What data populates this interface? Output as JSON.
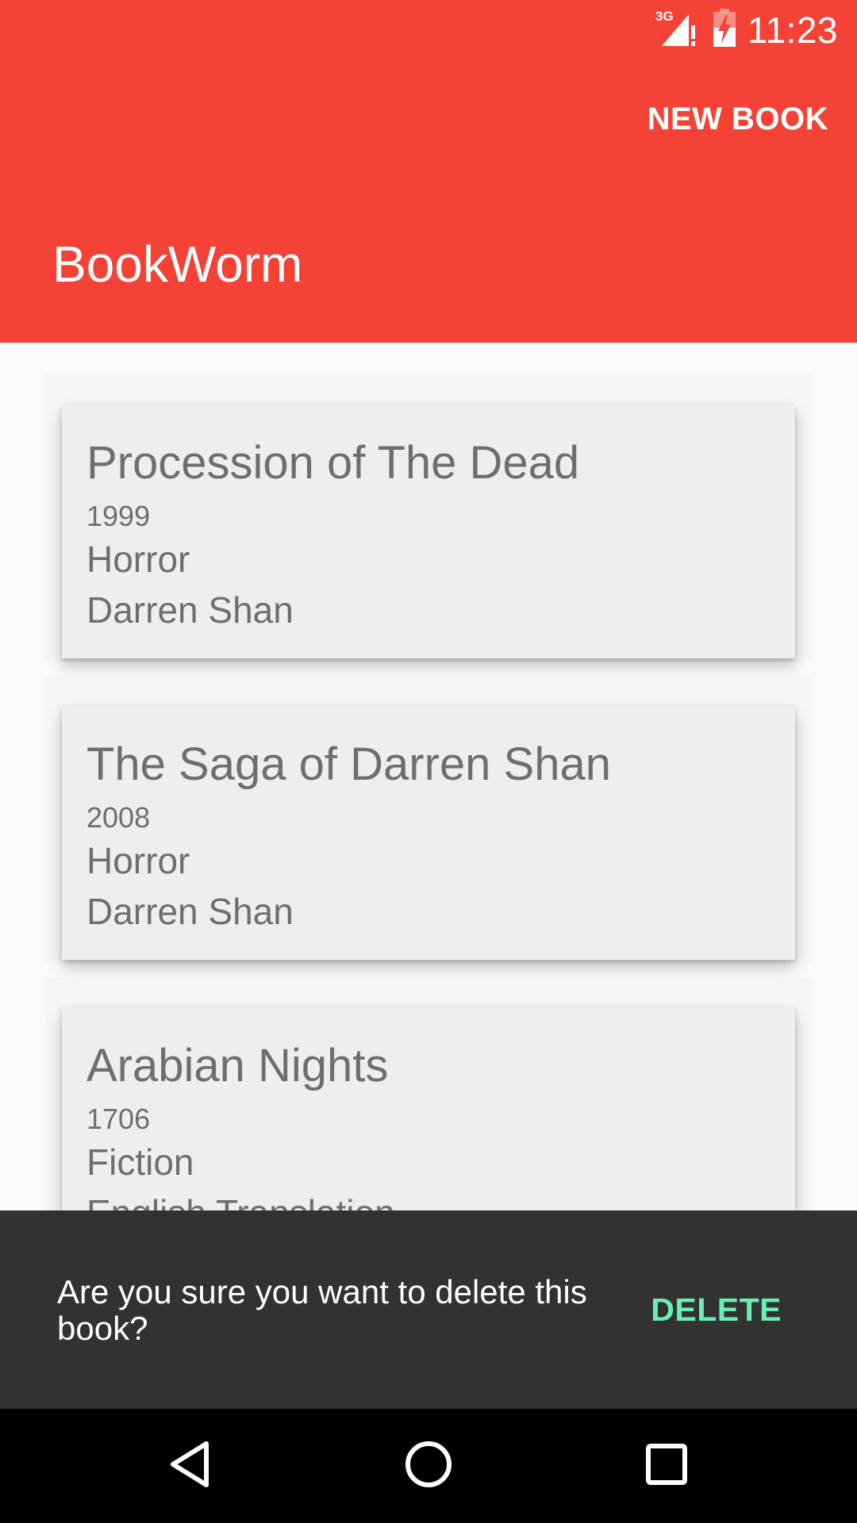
{
  "status_bar": {
    "network": "3G",
    "time": "11:23",
    "signal_icon": "signal-alert-icon",
    "battery_icon": "battery-charging-icon"
  },
  "app_bar": {
    "title": "BookWorm",
    "action_label": "NEW BOOK",
    "color": "#f44336"
  },
  "books": [
    {
      "title": "Procession of The Dead",
      "year": "1999",
      "genre": "Horror",
      "author": "Darren Shan"
    },
    {
      "title": "The Saga of Darren Shan",
      "year": "2008",
      "genre": "Horror",
      "author": "Darren Shan"
    },
    {
      "title": "Arabian Nights",
      "year": "1706",
      "genre": "Fiction",
      "author": "English Translation"
    }
  ],
  "snackbar": {
    "message": "Are you sure you want to delete this book?",
    "action_label": "DELETE",
    "action_color": "#69f0ae"
  },
  "nav_bar": {
    "back_icon": "back-triangle-icon",
    "home_icon": "home-circle-icon",
    "recents_icon": "recents-square-icon"
  }
}
